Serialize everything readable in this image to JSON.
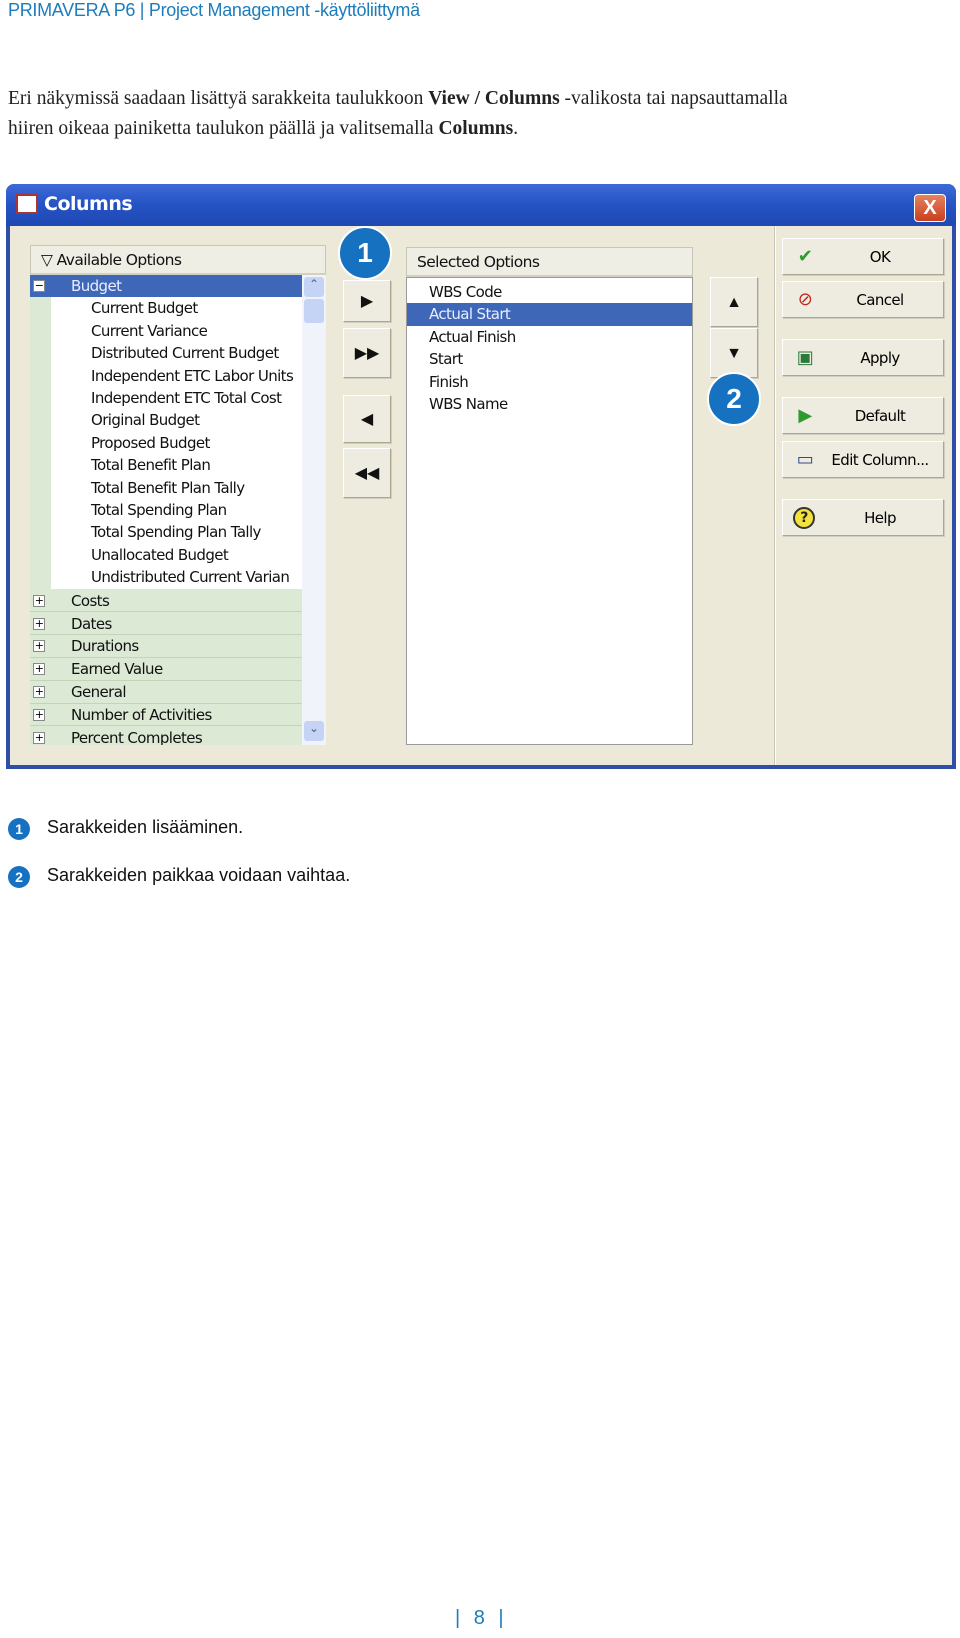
{
  "header": {
    "title": "PRIMAVERA P6 | Project Management -käyttöliittymä"
  },
  "intro": {
    "line1_a": "Eri näkymissä saadaan lisättyä sarakkeita taulukkoon ",
    "line1_b": "View / Columns",
    "line1_c": " -valikosta tai napsauttamalla",
    "line2_a": "hiiren oikeaa painiketta taulukon päällä ja valitsemalla ",
    "line2_b": "Columns",
    "line2_c": "."
  },
  "dialog": {
    "title": "Columns",
    "close_label": "X",
    "available": {
      "header": "Available Options",
      "expanded_group": "Budget",
      "children": [
        "Current Budget",
        "Current Variance",
        "Distributed Current Budget",
        "Independent ETC Labor Units",
        "Independent ETC Total Cost",
        "Original Budget",
        "Proposed Budget",
        "Total Benefit Plan",
        "Total Benefit Plan Tally",
        "Total Spending Plan",
        "Total Spending Plan Tally",
        "Unallocated Budget",
        "Undistributed Current Varian"
      ],
      "collapsed_groups": [
        "Costs",
        "Dates",
        "Durations",
        "Earned Value",
        "General",
        "Number of Activities",
        "Percent Completes"
      ]
    },
    "selected": {
      "header": "Selected Options",
      "items": [
        "WBS Code",
        "Actual Start",
        "Actual Finish",
        "Start",
        "Finish",
        "WBS Name"
      ],
      "selected_item": "Actual Start"
    },
    "buttons": [
      {
        "label": "OK",
        "icon": "checkmark-icon"
      },
      {
        "label": "Cancel",
        "icon": "cancel-icon"
      },
      {
        "label": "Apply",
        "icon": "apply-icon"
      },
      {
        "label": "Default",
        "icon": "play-icon"
      },
      {
        "label": "Edit Column...",
        "icon": "edit-column-icon"
      },
      {
        "label": "Help",
        "icon": "help-icon"
      }
    ],
    "badges": [
      "1",
      "2"
    ]
  },
  "footnotes": [
    {
      "num": "1",
      "text": "Sarakkeiden lisääminen."
    },
    {
      "num": "2",
      "text": "Sarakkeiden paikkaa voidaan vaihtaa."
    }
  ],
  "page_number": "| 8 |",
  "colors": {
    "accent": "#1b7dbb",
    "selection": "#3e67b8",
    "titlebar": "#2553c4",
    "group_bg": "#dce9d5"
  }
}
